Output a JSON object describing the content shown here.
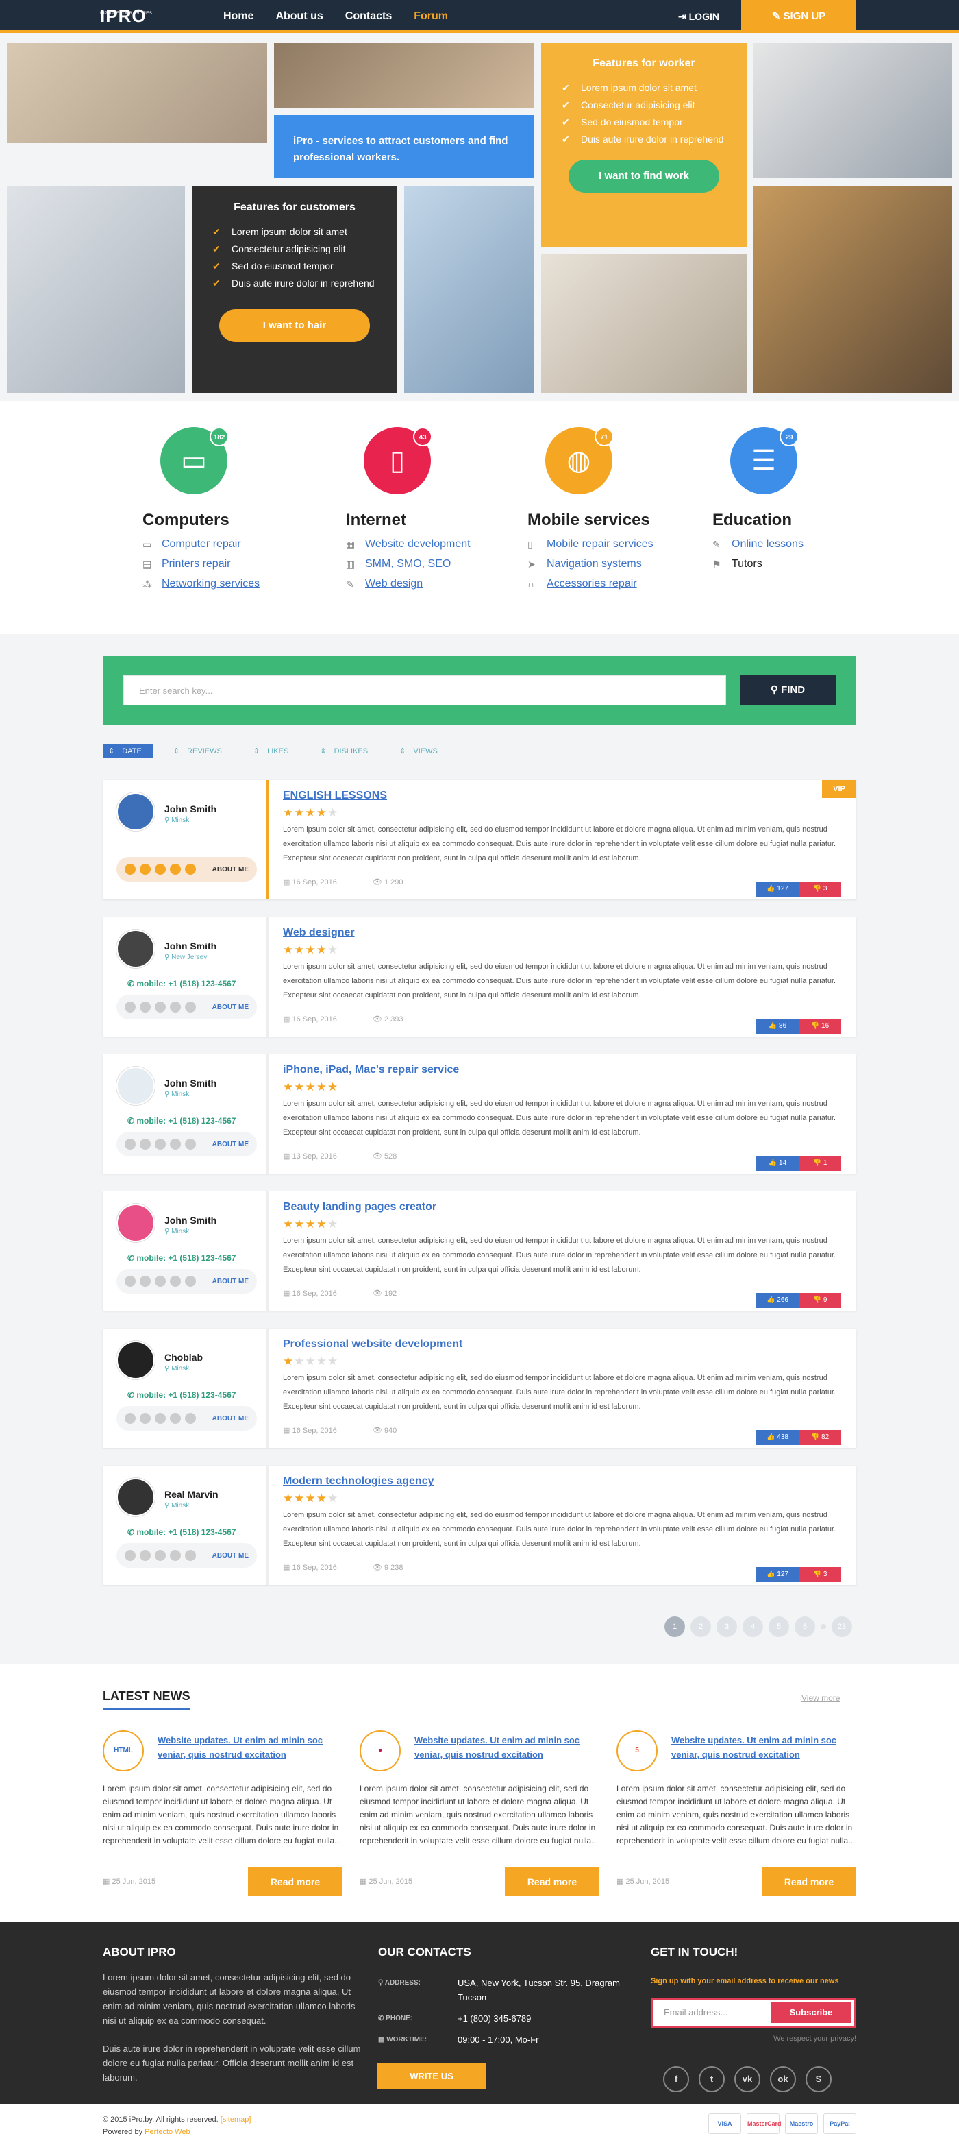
{
  "header": {
    "logo": "IPRO",
    "tagline": "IMPROVE YOUR ABILITIES",
    "nav": [
      "Home",
      "About us",
      "Contacts",
      "Forum"
    ],
    "login": "LOGIN",
    "signup": "SIGN UP"
  },
  "hero": {
    "blue_text": "iPro - services to attract customers and find professional workers.",
    "worker": {
      "title": "Features for worker",
      "items": [
        "Lorem ipsum dolor sit amet",
        "Consectetur adipisicing elit",
        "Sed do eiusmod tempor",
        "Duis aute irure dolor in reprehend"
      ],
      "button": "I want to find work"
    },
    "customer": {
      "title": "Features for customers",
      "items": [
        "Lorem ipsum dolor sit amet",
        "Consectetur adipisicing elit",
        "Sed do eiusmod tempor",
        "Duis aute irure dolor in reprehend"
      ],
      "button": "I want to hair"
    }
  },
  "categories": [
    {
      "title": "Computers",
      "count": "182",
      "color": "#3db876",
      "links": [
        "Computer repair",
        "Printers repair",
        "Networking services"
      ]
    },
    {
      "title": "Internet",
      "count": "43",
      "color": "#e8234d",
      "links": [
        "Website development",
        "SMM, SMO, SEO",
        "Web design"
      ]
    },
    {
      "title": "Mobile services",
      "count": "71",
      "color": "#f5a623",
      "links": [
        "Mobile repair services",
        "Navigation systems",
        "Accessories repair"
      ]
    },
    {
      "title": "Education",
      "count": "29",
      "color": "#3d8ee8",
      "links": [
        "Online lessons",
        "Tutors"
      ]
    }
  ],
  "search": {
    "placeholder": "Enter search key...",
    "button": "FIND"
  },
  "sort": [
    "DATE",
    "REVIEWS",
    "LIKES",
    "DISLIKES",
    "VIEWS"
  ],
  "listings": [
    {
      "name": "John Smith",
      "loc": "Minsk",
      "about": "ABOUT ME",
      "title": "ENGLISH LESSONS",
      "rating": 4,
      "date": "16 Sep, 2016",
      "views": "1 290",
      "likes": "127",
      "dislikes": "3",
      "vip": "VIP"
    },
    {
      "name": "John Smith",
      "loc": "New Jersey",
      "phone": "mobile: +1 (518) 123-4567",
      "about": "ABOUT ME",
      "title": "Web designer",
      "rating": 4,
      "date": "16 Sep, 2016",
      "views": "2 393",
      "likes": "86",
      "dislikes": "16"
    },
    {
      "name": "John Smith",
      "loc": "Minsk",
      "phone": "mobile: +1 (518) 123-4567",
      "about": "ABOUT ME",
      "title": "iPhone, iPad, Mac's repair service",
      "rating": 5,
      "date": "13 Sep, 2016",
      "views": "528",
      "likes": "14",
      "dislikes": "1"
    },
    {
      "name": "John Smith",
      "loc": "Minsk",
      "phone": "mobile: +1 (518) 123-4567",
      "about": "ABOUT ME",
      "title": "Beauty landing pages creator",
      "rating": 4,
      "date": "16 Sep, 2016",
      "views": "192",
      "likes": "266",
      "dislikes": "9"
    },
    {
      "name": "Choblab",
      "loc": "Minsk",
      "phone": "mobile: +1 (518) 123-4567",
      "about": "ABOUT ME",
      "title": "Professional website development",
      "rating": 1,
      "date": "16 Sep, 2016",
      "views": "940",
      "likes": "438",
      "dislikes": "82"
    },
    {
      "name": "Real Marvin",
      "loc": "Minsk",
      "phone": "mobile: +1 (518) 123-4567",
      "about": "ABOUT ME",
      "title": "Modern technologies agency",
      "rating": 4,
      "date": "16 Sep, 2016",
      "views": "9 238",
      "likes": "127",
      "dislikes": "3"
    }
  ],
  "listing_text": "Lorem ipsum dolor sit amet, consectetur adipisicing elit, sed do eiusmod tempor incididunt ut labore et dolore magna aliqua. Ut enim ad minim veniam, quis nostrud exercitation ullamco laboris nisi ut aliquip ex ea commodo consequat. Duis aute irure dolor in reprehenderit in voluptate velit esse cillum dolore eu fugiat nulla pariatur. Excepteur sint occaecat cupidatat non proident, sunt in culpa qui officia deserunt mollit anim id est laborum.",
  "pager": [
    "1",
    "2",
    "3",
    "4",
    "5",
    "6",
    "23"
  ],
  "news": {
    "title": "LATEST NEWS",
    "more": "View more",
    "items": [
      {
        "icon": "HTML School",
        "title": "Website updates. Ut enim ad minin soc veniar, quis nostrud excitation",
        "date": "25 Jun, 2015",
        "button": "Read more"
      },
      {
        "icon": "Raspberry",
        "title": "Website updates. Ut enim ad minin soc veniar, quis nostrud excitation",
        "date": "25 Jun, 2015",
        "button": "Read more"
      },
      {
        "icon": "HTML5",
        "title": "Website updates. Ut enim ad minin soc veniar, quis nostrud excitation",
        "date": "25 Jun, 2015",
        "button": "Read more"
      }
    ],
    "text": "Lorem ipsum dolor sit amet, consectetur adipisicing elit, sed do eiusmod tempor incididunt ut labore et dolore magna aliqua. Ut enim ad minim veniam, quis nostrud exercitation ullamco laboris nisi ut aliquip ex ea commodo consequat. Duis aute irure dolor in reprehenderit in voluptate velit esse cillum dolore eu fugiat nulla..."
  },
  "footer": {
    "about_title": "ABOUT IPRO",
    "about_1": "Lorem ipsum dolor sit amet, consectetur adipisicing elit, sed do eiusmod tempor incididunt ut labore et dolore magna aliqua. Ut enim ad minim veniam, quis nostrud exercitation ullamco laboris nisi ut aliquip ex ea commodo consequat.",
    "about_2": "Duis aute irure dolor in reprehenderit in voluptate velit esse cillum dolore eu fugiat nulla pariatur. Officia deserunt mollit anim id est laborum.",
    "contacts_title": "OUR CONTACTS",
    "address_label": "ADDRESS:",
    "address": "USA, New York, Tucson Str. 95, Dragram Tucson",
    "phone_label": "PHONE:",
    "phone": "+1 (800) 345-6789",
    "work_label": "WORKTIME:",
    "work": "09:00 - 17:00, Mo-Fr",
    "write": "WRITE US",
    "touch_title": "GET IN TOUCH!",
    "touch_sub": "Sign up with your email address to receive our news",
    "email_ph": "Email address...",
    "subscribe": "Subscribe",
    "privacy": "We respect your privacy!",
    "copyright": "© 2015 iPro.by. All rights reserved.",
    "sitemap": "[sitemap]",
    "powered": "Powered by",
    "powered_by": "Perfecto Web",
    "payments": [
      "VISA",
      "MasterCard",
      "Maestro",
      "PayPal"
    ]
  }
}
